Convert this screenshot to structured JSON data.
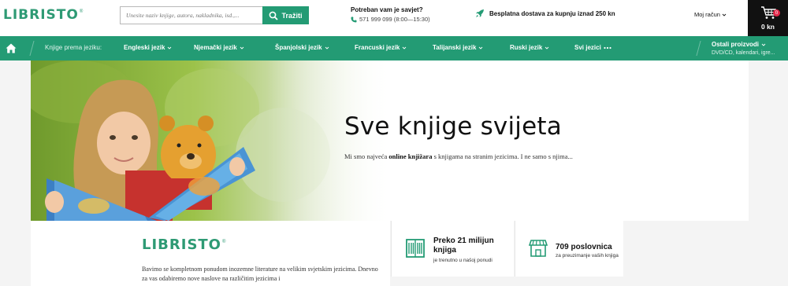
{
  "brand": {
    "name": "LIBRISTO",
    "registered": "®",
    "accent": "#239b74",
    "logo_color": "#2e9a74"
  },
  "header": {
    "search_placeholder": "Unesite naziv knjige, autora, nakladnika, isd.,...",
    "search_button": "Tražiti",
    "help_title": "Potreban vam je savjet?",
    "help_phone": "571 999 099 (8:00—15:30)",
    "shipping": "Besplatna dostava za kupnju iznad 250 kn",
    "account": "Moj račun",
    "cart_count": "0",
    "cart_total": "0 kn"
  },
  "nav": {
    "label": "Knjige prema jeziku:",
    "items": [
      {
        "label": "Engleski jezik"
      },
      {
        "label": "Njemački jezik"
      },
      {
        "label": "Španjolski jezik"
      },
      {
        "label": "Francuski jezik"
      },
      {
        "label": "Talijanski jezik"
      },
      {
        "label": "Ruski jezik"
      },
      {
        "label": "Svi jezici"
      }
    ],
    "more_title": "Ostali proizvodi",
    "more_sub": "DVD/CD, kalendari, igre..."
  },
  "hero": {
    "title": "Sve knjige svijeta",
    "text_before": "Mi smo najveća ",
    "text_bold": "online knjižara",
    "text_after": " s knjigama na stranim jezicima. I ne samo s njima..."
  },
  "about": {
    "text": "Bavimo se kompletnom ponudom inozemne literature na velikim svjetskim jezicima. Dnevno za vas odabiremo nove naslove na različitim jezicima i"
  },
  "stats": [
    {
      "title": "Preko 21 milijun knjiga",
      "sub": "je trenutno u našoj ponudi"
    },
    {
      "title": "709 poslovnica",
      "sub": "za preuzimanje vaših knjiga"
    }
  ]
}
